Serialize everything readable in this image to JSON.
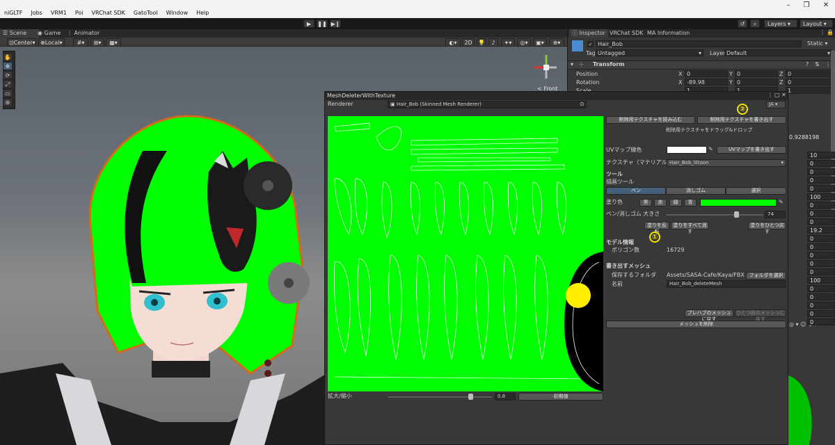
{
  "menu": [
    "niGLTF",
    "Jobs",
    "VRM1",
    "Poi",
    "VRChat SDK",
    "GatoTool",
    "Window",
    "Help"
  ],
  "toolbar": {
    "layers": "Layers",
    "layout": "Layout"
  },
  "scene": {
    "tabs": [
      "Scene",
      "Game",
      "Animator"
    ],
    "center_label": "Center",
    "local_label": "Local",
    "two_d": "2D",
    "front_label": "< Front"
  },
  "inspector": {
    "tabs": [
      "Inspector",
      "VRChat SDK",
      "MA Information"
    ],
    "object_name": "Hair_Bob",
    "static_label": "Static",
    "tag_label": "Tag",
    "tag_value": "Untagged",
    "layer_label": "Layer",
    "layer_value": "Default",
    "transform_title": "Transform",
    "position_label": "Position",
    "rotation_label": "Rotation",
    "scale_label": "Scale",
    "position": {
      "x": "0",
      "y": "0",
      "z": "0"
    },
    "rotation": {
      "x": "-89.98",
      "y": "0",
      "z": "0"
    },
    "scale": {
      "x": "1",
      "y": "1",
      "z": "1"
    },
    "partial_value": "0.9288198",
    "side_values": [
      "10",
      "0",
      "0",
      "0",
      "0",
      "100",
      "0",
      "0",
      "0",
      "19.2",
      "0",
      "0",
      "0",
      "0",
      "0",
      "100",
      "0",
      "0",
      "0",
      "0",
      "0"
    ]
  },
  "mesh_deleter": {
    "title": "MeshDeleterWithTexture",
    "renderer_label": "Renderer",
    "renderer_value": "Hair_Bob (Skinned Mesh Renderer)",
    "lang": "JA",
    "load_button": "削除用テクスチャを読み込む",
    "export_button": "削除用テクスチャを書き出す",
    "drop_hint": "削除用テクスチャをドラッグ&ドロップ",
    "uv_color_label": "UVマップ線色",
    "uv_export_button": "UVマップを書き出す",
    "texture_label": "テクスチャ（マテリアル）",
    "texture_value": "Hair_Bob_liltoon",
    "tools_header": "ツール",
    "draw_tool_label": "描画ツール",
    "tool_tabs": [
      "ペン",
      "消しゴム",
      "選択"
    ],
    "paint_color_label": "塗り色",
    "color_buttons": [
      "黒",
      "赤",
      "緑",
      "青"
    ],
    "brush_label": "ペン/消しゴム 大きさ",
    "brush_size": "74",
    "invert_button": "塗りを反転",
    "clear_button": "塗りをすべて消す",
    "undo_paint_button": "塗りをひとつ戻す",
    "model_header": "モデル情報",
    "polygon_label": "ポリゴン数",
    "polygon_count": "16729",
    "output_header": "書き出すメッシュ",
    "folder_label": "保存するフォルダ",
    "folder_value": "Assets/SASA-Cafe/Kaya/FBX",
    "select_folder_button": "フォルダを選択",
    "name_label": "名前",
    "name_value": "Hair_Bob_deleteMesh",
    "revert_prefab_button": "プレハブのメッシュに戻す",
    "revert_prev_button": "ひとつ前のメッシュに戻す",
    "delete_mesh_button": "メッシュを削除",
    "zoom_label": "拡大/縮小",
    "zoom_value": "0.8",
    "reset_button": "初期値",
    "markers": [
      "①",
      "②"
    ]
  },
  "colors": {
    "uv_green": "#00ff00",
    "marker_yellow": "#f2e600",
    "tab_selected": "#46607c"
  }
}
